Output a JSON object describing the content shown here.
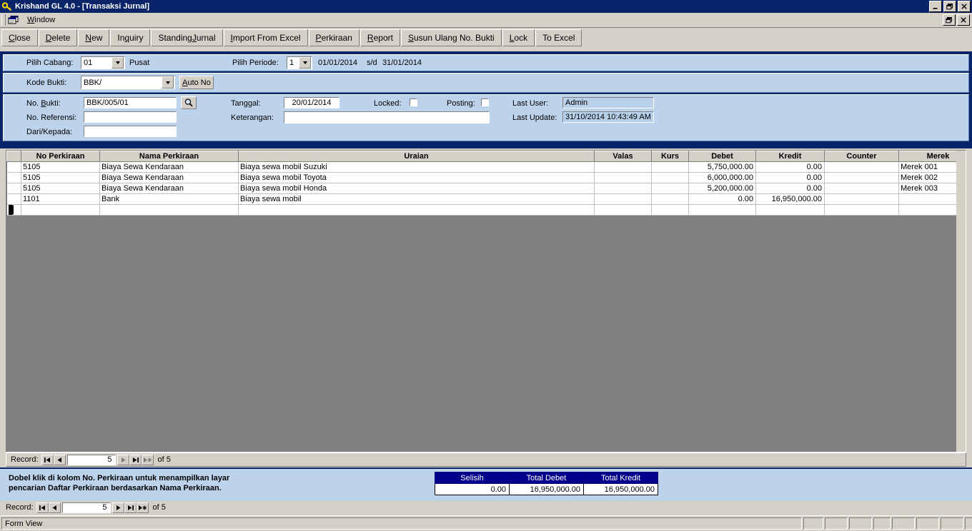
{
  "window": {
    "title": "Krishand GL 4.0 - [Transaksi Jurnal]",
    "icon": "key-icon",
    "minimize": "minimize-icon",
    "restore": "restore-icon",
    "close": "close-icon"
  },
  "menubar": {
    "mdi_icon": "mdi-window-icon",
    "items": [
      {
        "label": "Window",
        "accel": "W"
      }
    ],
    "child_restore": "restore-icon",
    "child_close": "close-icon"
  },
  "toolbar": {
    "buttons": [
      {
        "label": "Close",
        "accel": "C"
      },
      {
        "label": "Delete",
        "accel": "D"
      },
      {
        "label": "New",
        "accel": "N"
      },
      {
        "label": "Inquiry",
        "accel": "q"
      },
      {
        "label": "Standing Jurnal",
        "accel": "J"
      },
      {
        "label": "Import From Excel",
        "accel": "I"
      },
      {
        "label": "Perkiraan",
        "accel": "P"
      },
      {
        "label": "Report",
        "accel": "R"
      },
      {
        "label": "Susun Ulang No. Bukti",
        "accel": "S"
      },
      {
        "label": "Lock",
        "accel": "L"
      },
      {
        "label": "To Excel",
        "accel": ""
      }
    ]
  },
  "branch_panel": {
    "cabang_label": "Pilih Cabang:",
    "cabang_value": "01",
    "cabang_name": "Pusat",
    "periode_label": "Pilih Periode:",
    "periode_value": "1",
    "periode_from": "01/01/2014",
    "periode_sep": "s/d",
    "periode_to": "31/01/2014"
  },
  "kode_panel": {
    "kode_label": "Kode Bukti:",
    "kode_value": "BBK/",
    "auto_no_label": "Auto No",
    "auto_no_accel": "A"
  },
  "header_panel": {
    "no_bukti_label": "No. Bukti:",
    "no_bukti_accel": "B",
    "no_bukti_value": "BBK/005/01",
    "search_icon": "magnifier-icon",
    "no_referensi_label": "No. Referensi:",
    "no_referensi_value": "",
    "dari_kepada_label": "Dari/Kepada:",
    "dari_kepada_value": "",
    "tanggal_label": "Tanggal:",
    "tanggal_value": "20/01/2014",
    "keterangan_label": "Keterangan:",
    "keterangan_value": "",
    "locked_label": "Locked:",
    "locked_checked": false,
    "posting_label": "Posting:",
    "posting_checked": false,
    "last_user_label": "Last User:",
    "last_user_value": "Admin",
    "last_update_label": "Last Update:",
    "last_update_value": "31/10/2014 10:43:49 AM"
  },
  "grid": {
    "columns": [
      "No Perkiraan",
      "Nama Perkiraan",
      "Uraian",
      "Valas",
      "Kurs",
      "Debet",
      "Kredit",
      "Counter",
      "Merek"
    ],
    "rows": [
      {
        "no_perkiraan": "5105",
        "nama_perkiraan": "Biaya Sewa Kendaraan",
        "uraian": "Biaya sewa mobil Suzuki",
        "valas": "",
        "kurs": "",
        "debet": "5,750,000.00",
        "kredit": "0.00",
        "counter": "",
        "merek": "Merek 001"
      },
      {
        "no_perkiraan": "5105",
        "nama_perkiraan": "Biaya Sewa Kendaraan",
        "uraian": "Biaya sewa mobil Toyota",
        "valas": "",
        "kurs": "",
        "debet": "6,000,000.00",
        "kredit": "0.00",
        "counter": "",
        "merek": "Merek 002"
      },
      {
        "no_perkiraan": "5105",
        "nama_perkiraan": "Biaya Sewa Kendaraan",
        "uraian": "Biaya sewa mobil Honda",
        "valas": "",
        "kurs": "",
        "debet": "5,200,000.00",
        "kredit": "0.00",
        "counter": "",
        "merek": "Merek 003"
      },
      {
        "no_perkiraan": "1101",
        "nama_perkiraan": "Bank",
        "uraian": "Biaya sewa mobil",
        "valas": "",
        "kurs": "",
        "debet": "0.00",
        "kredit": "16,950,000.00",
        "counter": "",
        "merek": ""
      }
    ],
    "new_row": {
      "no_perkiraan": "",
      "nama_perkiraan": "",
      "uraian": "",
      "valas": "",
      "kurs": "",
      "debet": "",
      "kredit": "",
      "counter": "",
      "merek": ""
    }
  },
  "nav_top": {
    "label": "Record:",
    "value": "5",
    "of_text": "of  5",
    "first": "first-record-icon",
    "prev": "prev-record-icon",
    "next": "next-record-icon",
    "last": "last-record-icon",
    "new": "new-record-icon"
  },
  "nav_bottom": {
    "label": "Record:",
    "value": "5",
    "of_text": "of  5",
    "first": "first-record-icon",
    "prev": "prev-record-icon",
    "next": "next-record-icon",
    "last": "last-record-icon",
    "new": "new-record-icon"
  },
  "hint": {
    "line1": "Dobel klik di kolom No. Perkiraan untuk menampilkan layar",
    "line2": "pencarian Daftar Perkiraan berdasarkan Nama Perkiraan."
  },
  "totals": {
    "selisih_label": "Selisih",
    "total_debet_label": "Total Debet",
    "total_kredit_label": "Total Kredit",
    "selisih_value": "0.00",
    "total_debet_value": "16,950,000.00",
    "total_kredit_value": "16,950,000.00"
  },
  "statusbar": {
    "text": "Form View"
  },
  "colors": {
    "titlebar": "#0a246a",
    "form_blue": "#bdd3ec",
    "face": "#d4d0c8",
    "sheet_bg": "#808080",
    "totals_header": "#00008b"
  }
}
